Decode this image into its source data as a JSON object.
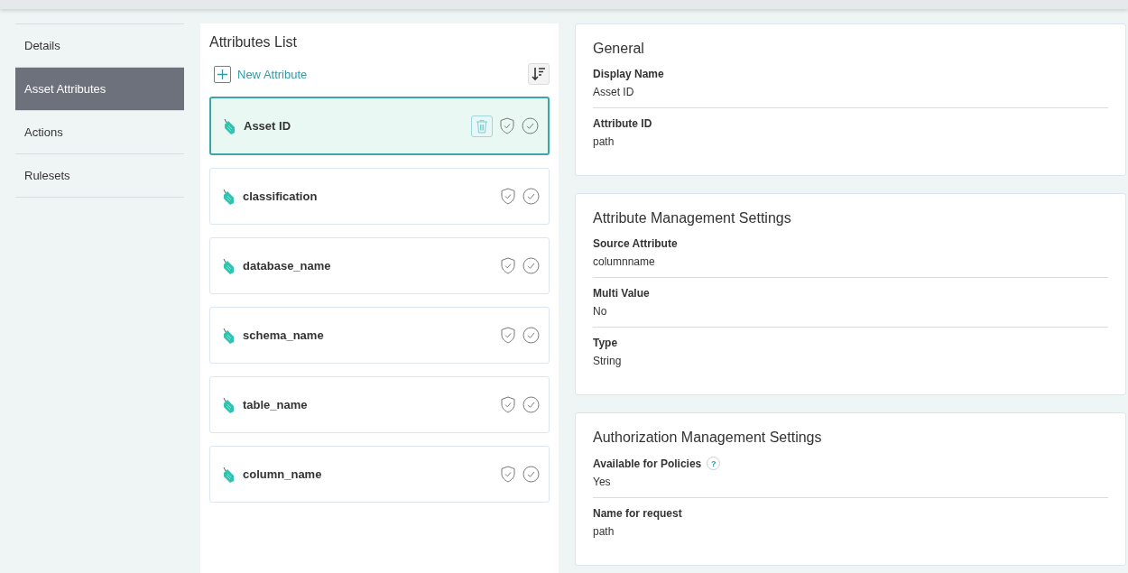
{
  "sidebar": {
    "items": [
      {
        "label": "Details",
        "selected": false
      },
      {
        "label": "Asset Attributes",
        "selected": true
      },
      {
        "label": "Actions",
        "selected": false
      },
      {
        "label": "Rulesets",
        "selected": false
      }
    ]
  },
  "attributes_list": {
    "title": "Attributes List",
    "new_button": "New Attribute",
    "items": [
      {
        "name": "Asset ID",
        "selected": true
      },
      {
        "name": "classification",
        "selected": false
      },
      {
        "name": "database_name",
        "selected": false
      },
      {
        "name": "schema_name",
        "selected": false
      },
      {
        "name": "table_name",
        "selected": false
      },
      {
        "name": "column_name",
        "selected": false
      }
    ]
  },
  "sections": [
    {
      "title": "General",
      "fields": [
        {
          "label": "Display Name",
          "value": "Asset ID"
        },
        {
          "label": "Attribute ID",
          "value": "path"
        }
      ]
    },
    {
      "title": "Attribute Management Settings",
      "fields": [
        {
          "label": "Source Attribute",
          "value": "columnname"
        },
        {
          "label": "Multi Value",
          "value": "No"
        },
        {
          "label": "Type",
          "value": "String"
        }
      ]
    },
    {
      "title": "Authorization Management Settings",
      "fields": [
        {
          "label": "Available for Policies",
          "help": "?",
          "value": "Yes"
        },
        {
          "label": "Name for request",
          "value": "path"
        }
      ]
    }
  ]
}
